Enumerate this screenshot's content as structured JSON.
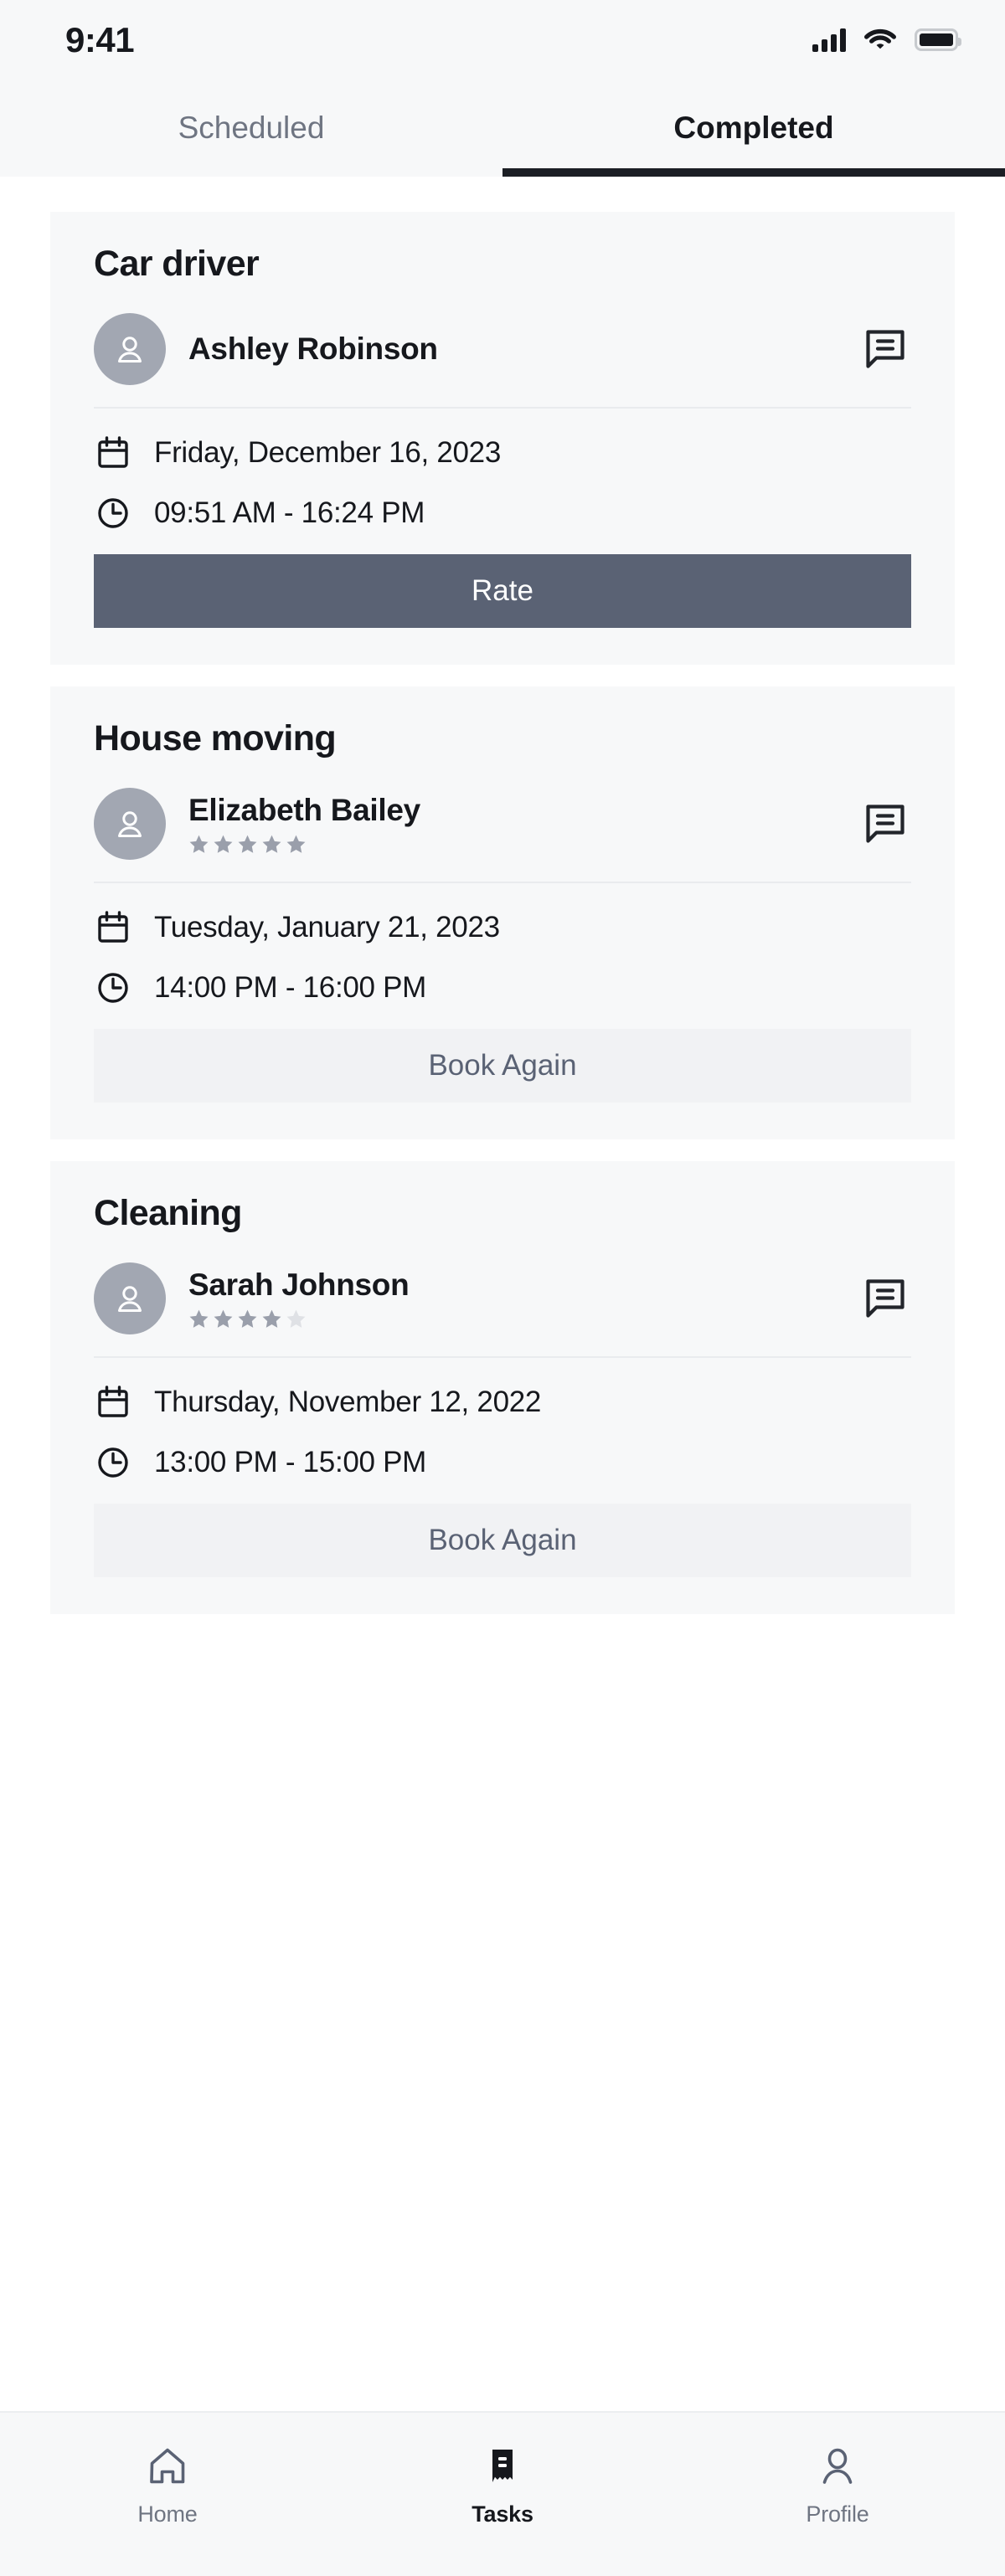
{
  "status_bar": {
    "time": "9:41",
    "icons": [
      "signal-icon",
      "wifi-icon",
      "battery-icon"
    ]
  },
  "tabs": [
    {
      "label": "Scheduled",
      "active": false
    },
    {
      "label": "Completed",
      "active": true
    }
  ],
  "colors": {
    "page_background": "#ffffff",
    "card_background": "#f7f8f9",
    "primary_button": "#5a6274",
    "secondary_button": "#f1f2f4",
    "text_primary": "#16181d",
    "text_muted": "#6f7582",
    "avatar": "#a2a7b2",
    "star_filled": "#9a9fab",
    "star_empty": "#dfe1e5",
    "active_tab_underline": "#1b1e24"
  },
  "cards": [
    {
      "title": "Car driver",
      "person": {
        "name": "Ashley Robinson",
        "rating": 0,
        "max_rating": 5,
        "show_rating": false
      },
      "date": "Friday, December 16, 2023",
      "time": "09:51 AM - 16:24 PM",
      "action": {
        "label": "Rate",
        "style": "primary"
      },
      "message_icon": "message-icon",
      "date_icon": "calendar-icon",
      "time_icon": "clock-icon"
    },
    {
      "title": "House moving",
      "person": {
        "name": "Elizabeth Bailey",
        "rating": 5,
        "max_rating": 5,
        "show_rating": true
      },
      "date": "Tuesday, January 21, 2023",
      "time": "14:00 PM - 16:00 PM",
      "action": {
        "label": "Book Again",
        "style": "secondary"
      },
      "message_icon": "message-icon",
      "date_icon": "calendar-icon",
      "time_icon": "clock-icon"
    },
    {
      "title": "Cleaning",
      "person": {
        "name": "Sarah Johnson",
        "rating": 4,
        "max_rating": 5,
        "show_rating": true
      },
      "date": "Thursday, November 12, 2022",
      "time": "13:00 PM - 15:00 PM",
      "action": {
        "label": "Book Again",
        "style": "secondary"
      },
      "message_icon": "message-icon",
      "date_icon": "calendar-icon",
      "time_icon": "clock-icon"
    }
  ],
  "bottom_nav": [
    {
      "label": "Home",
      "icon": "home-icon",
      "active": false
    },
    {
      "label": "Tasks",
      "icon": "tasks-icon",
      "active": true
    },
    {
      "label": "Profile",
      "icon": "profile-icon",
      "active": false
    }
  ]
}
